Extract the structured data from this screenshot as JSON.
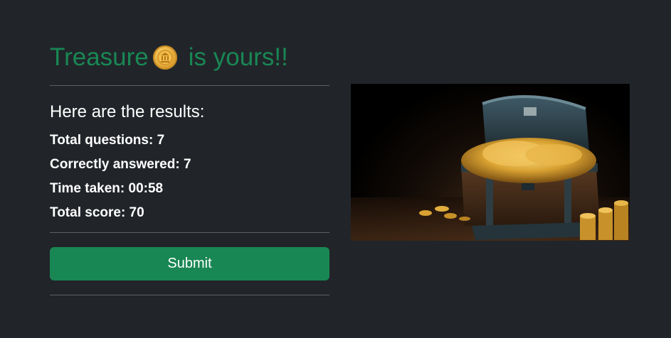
{
  "heading": {
    "word1": "Treasure",
    "coin_icon": "bank-coin-icon",
    "word2": "is yours!!",
    "color": "#198754"
  },
  "results": {
    "title": "Here are the results:",
    "rows": [
      {
        "label": "Total questions: 7"
      },
      {
        "label": "Correctly answered: 7"
      },
      {
        "label": "Time taken: 00:58"
      },
      {
        "label": "Total score: 70"
      }
    ]
  },
  "submit": {
    "label": "Submit",
    "color": "#198754"
  },
  "image": {
    "subject": "treasure-chest-image"
  },
  "theme": {
    "background": "#212529",
    "divider": "#5c6166"
  }
}
